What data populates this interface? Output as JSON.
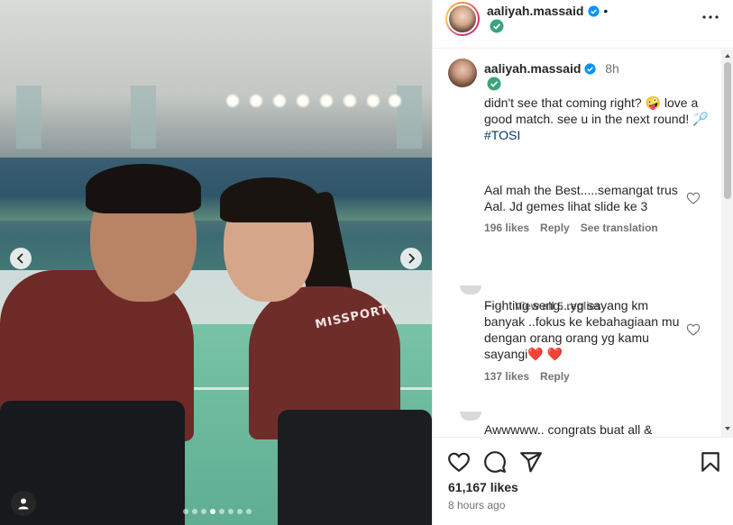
{
  "post": {
    "author": "aaliyah.massaid",
    "time": "8h",
    "caption": "didn't see that coming right? 🤪 love a good match. see u in the next round! 🏸 #TOSI",
    "caption_parts": {
      "text": "didn't see that coming right? 🤪 love a good match. see u in the next round! 🏸 ",
      "hashtag": "#TOSI"
    },
    "shirt_text": "MISSPORT",
    "carousel": {
      "count": 8,
      "active_index": 3
    }
  },
  "comments": [
    {
      "text": "Aal mah the Best.....semangat trus Aal. Jd gemes lihat slide ke 3",
      "likes": "196 likes",
      "reply": "Reply",
      "translation": "See translation"
    },
    {
      "text": "Fighting seng...yg sayang km banyak ..fokus ke kebahagiaan mu dengan orang orang yg kamu sayangi❤️ ❤️",
      "likes": "137 likes",
      "reply": "Reply"
    },
    {
      "text": "Awwwww.. congrats buat all &"
    }
  ],
  "view_replies": "View all 5 replies",
  "footer": {
    "likes": "61,167 likes",
    "ago": "8 hours ago"
  },
  "colors": {
    "verified": "#0095f6",
    "green_check": "#3aa57a",
    "text": "#262626",
    "muted": "#737373",
    "heart_red": "#ed4956"
  }
}
